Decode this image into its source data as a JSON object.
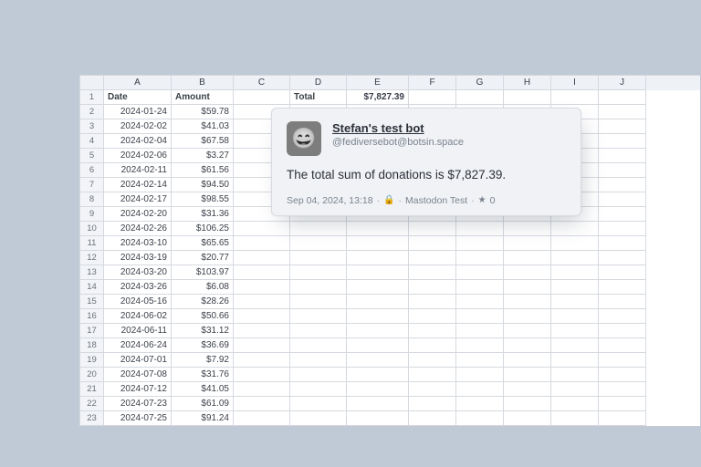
{
  "sheet": {
    "col_letters": [
      "A",
      "B",
      "C",
      "D",
      "E",
      "F",
      "G",
      "H",
      "I",
      "J"
    ],
    "headers": {
      "A": "Date",
      "B": "Amount",
      "D": "Total",
      "E": "$7,827.39"
    },
    "rows": [
      {
        "n": 2,
        "date": "2024-01-24",
        "amount": "$59.78"
      },
      {
        "n": 3,
        "date": "2024-02-02",
        "amount": "$41.03"
      },
      {
        "n": 4,
        "date": "2024-02-04",
        "amount": "$67.58"
      },
      {
        "n": 5,
        "date": "2024-02-06",
        "amount": "$3.27"
      },
      {
        "n": 6,
        "date": "2024-02-11",
        "amount": "$61.56"
      },
      {
        "n": 7,
        "date": "2024-02-14",
        "amount": "$94.50"
      },
      {
        "n": 8,
        "date": "2024-02-17",
        "amount": "$98.55"
      },
      {
        "n": 9,
        "date": "2024-02-20",
        "amount": "$31.36"
      },
      {
        "n": 10,
        "date": "2024-02-26",
        "amount": "$106.25"
      },
      {
        "n": 11,
        "date": "2024-03-10",
        "amount": "$65.65"
      },
      {
        "n": 12,
        "date": "2024-03-19",
        "amount": "$20.77"
      },
      {
        "n": 13,
        "date": "2024-03-20",
        "amount": "$103.97"
      },
      {
        "n": 14,
        "date": "2024-03-26",
        "amount": "$6.08"
      },
      {
        "n": 15,
        "date": "2024-05-16",
        "amount": "$28.26"
      },
      {
        "n": 16,
        "date": "2024-06-02",
        "amount": "$50.66"
      },
      {
        "n": 17,
        "date": "2024-06-11",
        "amount": "$31.12"
      },
      {
        "n": 18,
        "date": "2024-06-24",
        "amount": "$36.69"
      },
      {
        "n": 19,
        "date": "2024-07-01",
        "amount": "$7.92"
      },
      {
        "n": 20,
        "date": "2024-07-08",
        "amount": "$31.76"
      },
      {
        "n": 21,
        "date": "2024-07-12",
        "amount": "$41.05"
      },
      {
        "n": 22,
        "date": "2024-07-23",
        "amount": "$61.09"
      },
      {
        "n": 23,
        "date": "2024-07-25",
        "amount": "$91.24"
      }
    ]
  },
  "post": {
    "avatar_emoji": "😄",
    "display_name": "Stefan's test bot",
    "handle": "@fediversebot@botsin.space",
    "body": "The total sum of donations is $7,827.39.",
    "timestamp": "Sep 04, 2024, 13:18",
    "visibility_icon": "🔒",
    "source": "Mastodon Test",
    "fav_icon": "★",
    "fav_count": "0"
  }
}
